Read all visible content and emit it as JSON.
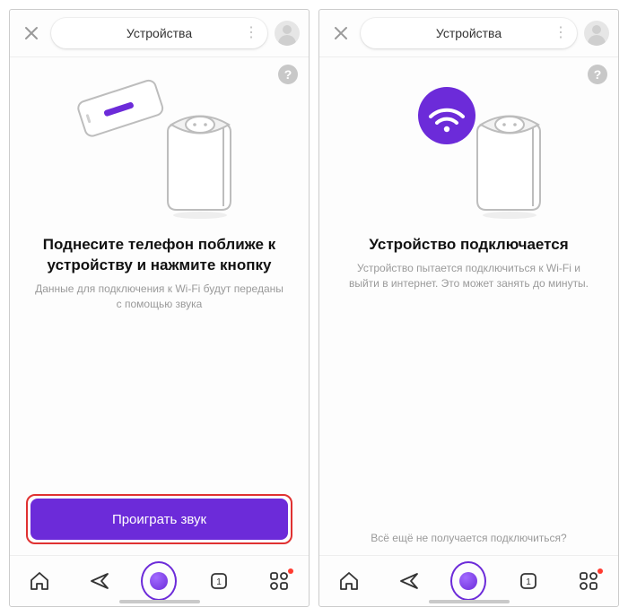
{
  "accent": "#6c2bd9",
  "highlight": "#e03131",
  "left": {
    "topbar_title": "Устройства",
    "headline": "Поднесите телефон поближе к устройству и нажмите кнопку",
    "subtext": "Данные для подключения к Wi-Fi будут переданы с помощью звука",
    "cta_label": "Проиграть звук",
    "nav_counter": "1"
  },
  "right": {
    "topbar_title": "Устройства",
    "headline": "Устройство подключается",
    "subtext": "Устройство пытается подключиться к Wi-Fi и выйти в интернет. Это может занять до минуты.",
    "help_link": "Всё ещё не получается подключиться?",
    "nav_counter": "1"
  }
}
